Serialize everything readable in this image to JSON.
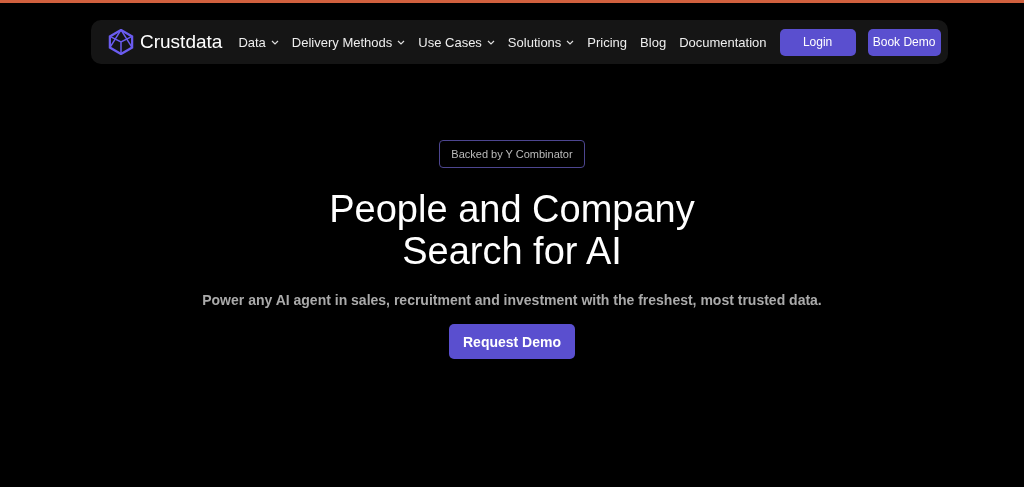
{
  "nav": {
    "brand": "Crustdata",
    "items": [
      {
        "label": "Data",
        "dropdown": true
      },
      {
        "label": "Delivery Methods",
        "dropdown": true
      },
      {
        "label": "Use Cases",
        "dropdown": true
      },
      {
        "label": "Solutions",
        "dropdown": true
      },
      {
        "label": "Pricing",
        "dropdown": false
      },
      {
        "label": "Blog",
        "dropdown": false
      },
      {
        "label": "Documentation",
        "dropdown": false
      }
    ],
    "buttons": [
      "Login",
      "Book Demo"
    ]
  },
  "hero": {
    "badge": "Backed by Y Combinator",
    "headline": [
      "People and Company",
      "Search for AI"
    ],
    "subtitle": "Power any AI agent in sales, recruitment and investment with the freshest, most trusted data.",
    "cta": "Request Demo"
  }
}
